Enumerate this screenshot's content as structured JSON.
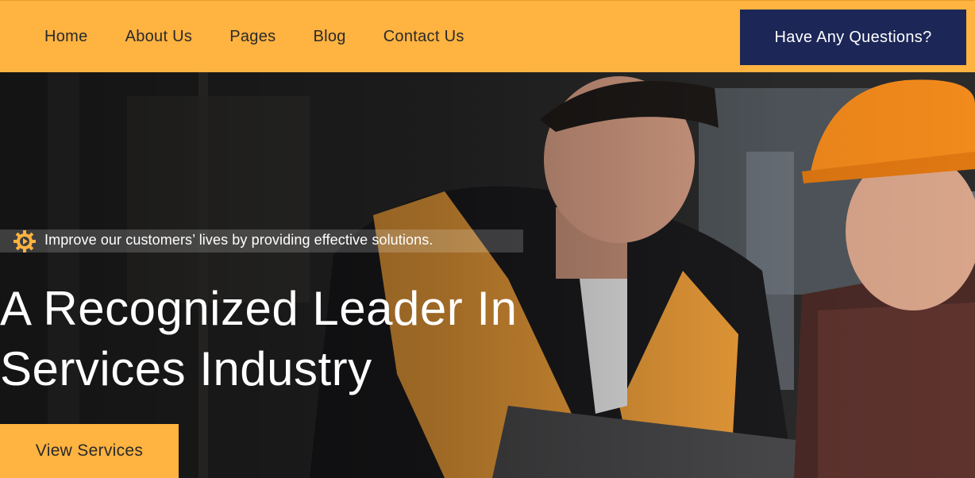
{
  "nav": {
    "items": [
      {
        "label": "Home"
      },
      {
        "label": "About Us"
      },
      {
        "label": "Pages"
      },
      {
        "label": "Blog"
      },
      {
        "label": "Contact Us"
      }
    ],
    "cta_label": "Have Any Questions?"
  },
  "hero": {
    "tagline_icon": "gear-play-icon",
    "tagline": "Improve our customers’ lives by providing effective solutions.",
    "headline_line1": "A Recognized Leader In",
    "headline_line2": "Services Industry",
    "button_label": "View Services"
  },
  "colors": {
    "accent": "#ffb340",
    "navy": "#1c2657",
    "text_dark": "#2a2a2a",
    "text_light": "#ffffff"
  }
}
